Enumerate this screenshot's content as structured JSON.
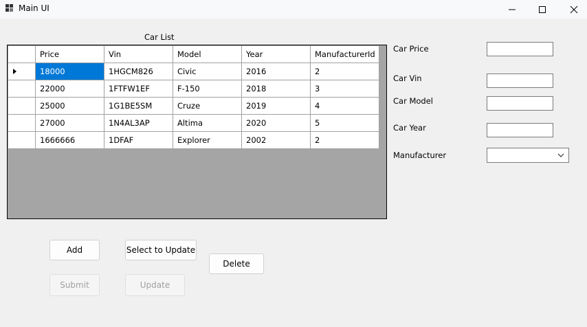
{
  "window": {
    "title": "Main UI"
  },
  "grid": {
    "caption": "Car List",
    "columns": [
      "Price",
      "Vin",
      "Model",
      "Year",
      "ManufacturerId"
    ],
    "rows": [
      [
        "18000",
        "1HGCM826",
        "Civic",
        "2016",
        "2"
      ],
      [
        "22000",
        "1FTFW1EF",
        "F-150",
        "2018",
        "3"
      ],
      [
        "25000",
        "1G1BE5SM",
        "Cruze",
        "2019",
        "4"
      ],
      [
        "27000",
        "1N4AL3AP",
        "Altima",
        "2020",
        "5"
      ],
      [
        "1666666",
        "1DFAF",
        "Explorer",
        "2002",
        "2"
      ]
    ],
    "selected_row": 0
  },
  "form": {
    "price_label": "Car Price",
    "vin_label": "Car Vin",
    "model_label": "Car Model",
    "year_label": "Car Year",
    "manufacturer_label": "Manufacturer",
    "price_value": "",
    "vin_value": "",
    "model_value": "",
    "year_value": "",
    "manufacturer_value": ""
  },
  "buttons": {
    "add": "Add",
    "select_to_update": "Select to Update",
    "delete": "Delete",
    "submit": "Submit",
    "update": "Update"
  },
  "colors": {
    "selection": "#0078d7",
    "grid_background": "#a5a5a5"
  }
}
